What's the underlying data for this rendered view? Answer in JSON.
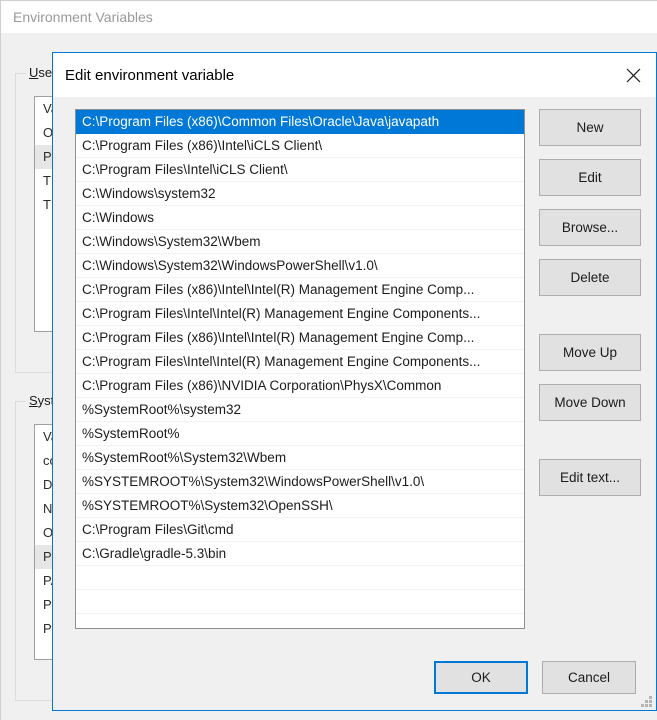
{
  "background_window": {
    "title": "Environment Variables",
    "user_section": {
      "legend_accel": "U",
      "legend_rest": "ser",
      "rows": [
        "Va",
        "On",
        "Pa",
        "TE",
        "TM"
      ],
      "selected_index": 2
    },
    "system_section": {
      "legend_accel": "S",
      "legend_rest": "yst",
      "rows": [
        "Va",
        "co",
        "Dr",
        "NU",
        "OS",
        "Pa",
        "PA",
        "PR",
        "PR"
      ],
      "selected_index": 5
    }
  },
  "dialog": {
    "title": "Edit environment variable",
    "close_icon": "close-icon",
    "paths": [
      "C:\\Program Files (x86)\\Common Files\\Oracle\\Java\\javapath",
      "C:\\Program Files (x86)\\Intel\\iCLS Client\\",
      "C:\\Program Files\\Intel\\iCLS Client\\",
      "C:\\Windows\\system32",
      "C:\\Windows",
      "C:\\Windows\\System32\\Wbem",
      "C:\\Windows\\System32\\WindowsPowerShell\\v1.0\\",
      "C:\\Program Files (x86)\\Intel\\Intel(R) Management Engine Comp...",
      "C:\\Program Files\\Intel\\Intel(R) Management Engine Components...",
      "C:\\Program Files (x86)\\Intel\\Intel(R) Management Engine Comp...",
      "C:\\Program Files\\Intel\\Intel(R) Management Engine Components...",
      "C:\\Program Files (x86)\\NVIDIA Corporation\\PhysX\\Common",
      "%SystemRoot%\\system32",
      "%SystemRoot%",
      "%SystemRoot%\\System32\\Wbem",
      "%SYSTEMROOT%\\System32\\WindowsPowerShell\\v1.0\\",
      "%SYSTEMROOT%\\System32\\OpenSSH\\",
      "C:\\Program Files\\Git\\cmd",
      "C:\\Gradle\\gradle-5.3\\bin"
    ],
    "selected_path_index": 0,
    "empty_rows": 2,
    "buttons": {
      "new": "New",
      "edit": "Edit",
      "browse": "Browse...",
      "delete": "Delete",
      "move_up": "Move Up",
      "move_down": "Move Down",
      "edit_text": "Edit text..."
    },
    "footer": {
      "ok": "OK",
      "cancel": "Cancel"
    }
  },
  "colors": {
    "selection_blue": "#0078d7",
    "dialog_face": "#f0f0f0",
    "button_face": "#e1e1e1"
  }
}
